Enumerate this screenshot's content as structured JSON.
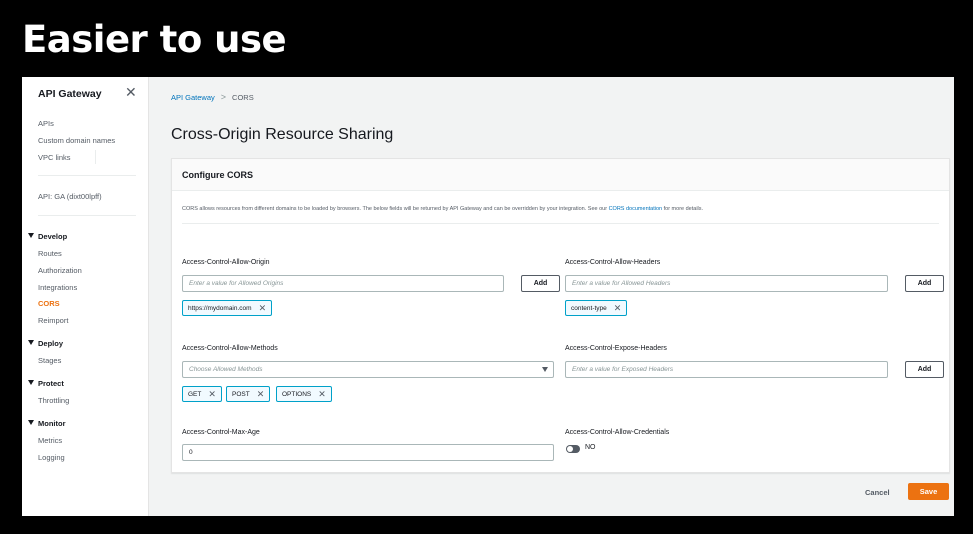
{
  "slide": {
    "title": "Easier to use"
  },
  "sidebar": {
    "title": "API Gateway",
    "close_icon": "close-icon",
    "top_items": [
      "APIs",
      "Custom domain names",
      "VPC links"
    ],
    "api_label": "API: GA (dixt00lpff)",
    "sections": [
      {
        "label": "Develop",
        "items": [
          "Routes",
          "Authorization",
          "Integrations",
          "CORS",
          "Reimport"
        ]
      },
      {
        "label": "Deploy",
        "items": [
          "Stages"
        ]
      },
      {
        "label": "Protect",
        "items": [
          "Throttling"
        ]
      },
      {
        "label": "Monitor",
        "items": [
          "Metrics",
          "Logging"
        ]
      }
    ],
    "active_item": "CORS"
  },
  "breadcrumb": {
    "root": "API Gateway",
    "separator": ">",
    "current": "CORS"
  },
  "page": {
    "title": "Cross-Origin Resource Sharing"
  },
  "panel": {
    "title": "Configure CORS",
    "description_prefix": "CORS allows resources from different domains to be loaded by browsers. The below fields will be returned by API Gateway and can be overridden by your integration. See our ",
    "description_link": "CORS documentation",
    "description_suffix": " for more details."
  },
  "fields": {
    "allow_origin": {
      "label": "Access-Control-Allow-Origin",
      "placeholder": "Enter a value for Allowed Origins",
      "add_label": "Add",
      "tokens": [
        "https://mydomain.com"
      ]
    },
    "allow_headers": {
      "label": "Access-Control-Allow-Headers",
      "placeholder": "Enter a value for Allowed Headers",
      "add_label": "Add",
      "tokens": [
        "content-type"
      ]
    },
    "allow_methods": {
      "label": "Access-Control-Allow-Methods",
      "placeholder": "Choose Allowed Methods",
      "tokens": [
        "GET",
        "POST",
        "OPTIONS"
      ]
    },
    "expose_headers": {
      "label": "Access-Control-Expose-Headers",
      "placeholder": "Enter a value for Exposed Headers",
      "add_label": "Add"
    },
    "max_age": {
      "label": "Access-Control-Max-Age",
      "value": "0"
    },
    "allow_credentials": {
      "label": "Access-Control-Allow-Credentials",
      "state": "NO"
    }
  },
  "footer": {
    "cancel_label": "Cancel",
    "save_label": "Save"
  },
  "colors": {
    "accent": "#ec7211",
    "link": "#0073bb",
    "token_border": "#00a1c9"
  }
}
